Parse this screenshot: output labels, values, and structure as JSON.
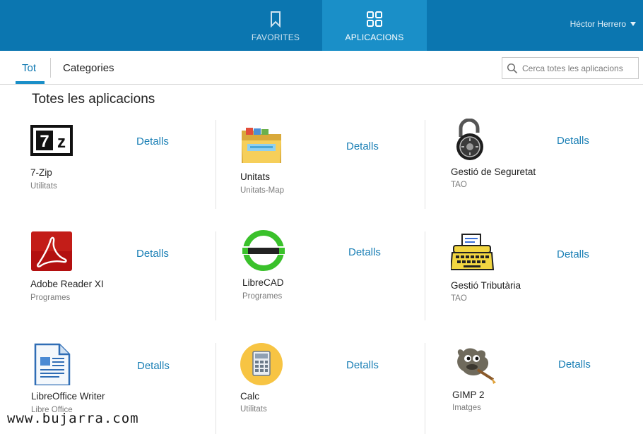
{
  "topbar": {
    "tabs": [
      {
        "label": "FAVORITES",
        "icon": "bookmark-icon",
        "active": false
      },
      {
        "label": "APLICACIONS",
        "icon": "grid-icon",
        "active": true
      }
    ],
    "user": {
      "name": "Héctor Herrero"
    },
    "colors": {
      "bar": "#0b76b0",
      "active_tab": "#1a8fc8"
    }
  },
  "subnav": {
    "tabs": [
      {
        "label": "Tot",
        "active": true
      },
      {
        "label": "Categories",
        "active": false
      }
    ],
    "search": {
      "placeholder": "Cerca totes les aplicacions",
      "value": ""
    }
  },
  "main": {
    "title": "Totes les aplicacions",
    "apps": [
      {
        "name": "7-Zip",
        "category": "Utilitats",
        "action": "Detalls",
        "icon": "7zip-icon"
      },
      {
        "name": "Unitats",
        "category": "Unitats-Map",
        "action": "Detalls",
        "icon": "folder-icon"
      },
      {
        "name": "Gestió de Seguretat",
        "category": "TAO",
        "action": "Detalls",
        "icon": "padlock-icon"
      },
      {
        "name": "Adobe Reader XI",
        "category": "Programes",
        "action": "Detalls",
        "icon": "adobe-reader-icon"
      },
      {
        "name": "LibreCAD",
        "category": "Programes",
        "action": "Detalls",
        "icon": "librecad-icon"
      },
      {
        "name": "Gestió Tributària",
        "category": "TAO",
        "action": "Detalls",
        "icon": "typewriter-icon"
      },
      {
        "name": "LibreOffice Writer",
        "category": "Libre Office",
        "action": "Detalls",
        "icon": "writer-icon"
      },
      {
        "name": "Calc",
        "category": "Utilitats",
        "action": "Detalls",
        "icon": "calculator-icon"
      },
      {
        "name": "GIMP 2",
        "category": "Imatges",
        "action": "Detalls",
        "icon": "gimp-icon"
      }
    ]
  },
  "watermark": "www.bujarra.com"
}
